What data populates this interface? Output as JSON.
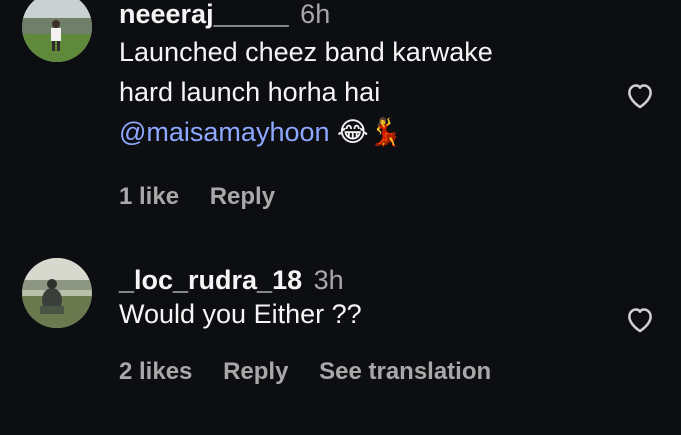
{
  "comments": [
    {
      "username": "neeeraj_____",
      "time": "6h",
      "text_line1": "Launched cheez band karwake",
      "text_line2": "hard launch horha hai",
      "mention": "@maisamayhoon",
      "emoji": "😂💃",
      "likes_label": "1 like",
      "reply_label": "Reply",
      "like_icon": "heart-outline-icon"
    },
    {
      "username": "_loc_rudra_18",
      "time": "3h",
      "text_line1": "Would you Either ??",
      "likes_label": "2 likes",
      "reply_label": "Reply",
      "translation_label": "See translation",
      "like_icon": "heart-outline-icon"
    }
  ]
}
